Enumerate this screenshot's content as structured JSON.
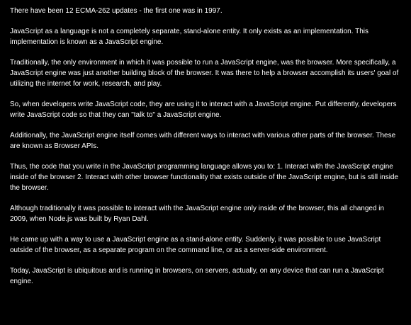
{
  "colors": {
    "background": "#000000",
    "text": "#ffffff"
  },
  "article": {
    "paragraphs": [
      "There have been 12 ECMA-262 updates - the first one was in 1997.",
      "JavaScript as a language is not a completely separate, stand-alone entity. It only exists as an implementation. This implementation is known as a JavaScript engine.",
      "Traditionally, the only environment in which it was possible to run a JavaScript engine, was the browser. More specifically, a JavaScript engine was just another building block of the browser. It was there to help a browser accomplish its users' goal of utilizing the internet for work, research, and play.",
      "So, when developers write JavaScript code, they are using it to interact with a JavaScript engine. Put differently, developers write JavaScript code so that they can \"talk to\" a JavaScript engine.",
      "Additionally, the JavaScript engine itself comes with different ways to interact with various other parts of the browser. These are known as Browser APIs.",
      "Thus, the code that you write in the JavaScript programming language allows you to: 1. Interact with the JavaScript engine inside of the browser 2. Interact with other browser functionality that exists outside of the JavaScript engine, but is still inside the browser.",
      "Although traditionally it was possible to interact with the JavaScript engine only inside of the browser, this all changed in 2009, when Node.js was built by Ryan Dahl.",
      "He came up with a way to use a JavaScript engine as a stand-alone entity. Suddenly, it was possible to use JavaScript outside of the browser, as a separate program on the command line, or as a server-side environment.",
      "Today, JavaScript is ubiquitous and is running in browsers, on servers, actually, on any device that can run a JavaScript engine."
    ]
  }
}
